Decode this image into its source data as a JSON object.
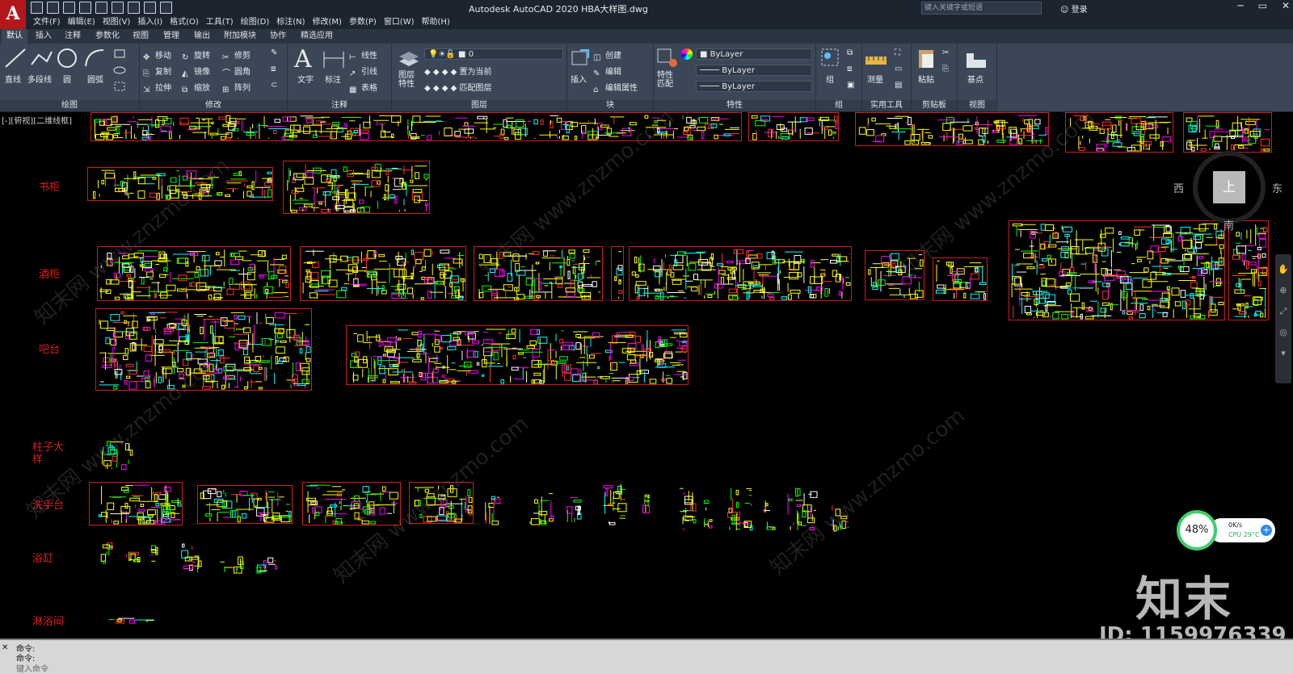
{
  "app": {
    "title": "Autodesk AutoCAD 2020    HBA大样图.dwg",
    "app_button": "A",
    "search_placeholder": "键入关键字或短语",
    "login": "登录",
    "window_controls": [
      "─",
      "▭",
      "✕"
    ]
  },
  "menubar": [
    "文件(F)",
    "编辑(E)",
    "视图(V)",
    "插入(I)",
    "格式(O)",
    "工具(T)",
    "绘图(D)",
    "标注(N)",
    "修改(M)",
    "参数(P)",
    "窗口(W)",
    "帮助(H)"
  ],
  "ribbon_tabs": [
    "默认",
    "插入",
    "注释",
    "参数化",
    "视图",
    "管理",
    "输出",
    "附加模块",
    "协作",
    "精选应用"
  ],
  "ribbon": {
    "draw": {
      "label": "绘图",
      "line": "直线",
      "polyline": "多段线",
      "circle": "圆",
      "arc": "圆弧"
    },
    "modify": {
      "label": "修改",
      "move": "移动",
      "rotate": "旋转",
      "trim": "修剪",
      "copy": "复制",
      "mirror": "镜像",
      "fillet": "圆角",
      "stretch": "拉伸",
      "scale": "缩放",
      "array": "阵列"
    },
    "annotation": {
      "label": "注释",
      "text": "文字",
      "dimension": "标注",
      "linear": "线性",
      "leader": "引线",
      "table": "表格"
    },
    "layers": {
      "label": "图层",
      "layer_props": "图层\n特性",
      "layer_value": "0",
      "set_current": "置为当前",
      "match_layer": "匹配图层"
    },
    "block": {
      "label": "块",
      "insert": "插入",
      "create": "创建",
      "edit": "编辑",
      "edit_attr": "编辑属性"
    },
    "properties": {
      "label": "特性",
      "match": "特性\n匹配",
      "color": "ByLayer",
      "linetype": "ByLayer",
      "lineweight": "ByLayer"
    },
    "groups": {
      "label": "组",
      "group": "组"
    },
    "utilities": {
      "label": "实用工具",
      "measure": "测量"
    },
    "clipboard": {
      "label": "剪贴板",
      "paste": "粘贴"
    },
    "view": {
      "label": "视图",
      "base": "基点"
    }
  },
  "canvas": {
    "view_label": "[-][俯视][二维线框]",
    "rows": [
      "书柜",
      "酒柜",
      "吧台",
      "柱子大样",
      "洗手台",
      "浴缸",
      "淋浴间"
    ],
    "viewcube": {
      "top": "上",
      "west": "西",
      "east": "东",
      "south": "南"
    }
  },
  "overlay": {
    "logo": "知末",
    "id": "ID: 1159976339",
    "watermark": "知末网 www.znzmo.com",
    "perf_percent": "48%",
    "net": "0K/s",
    "cpu": "CPU 29°C"
  },
  "command": {
    "history": [
      "命令:",
      "命令:"
    ],
    "prompt": "键入命令"
  },
  "colors": {
    "frame": "#d01c1c",
    "row_label": "#d81e1e",
    "ribbon": "#3b4756",
    "title": "#1c2430"
  }
}
